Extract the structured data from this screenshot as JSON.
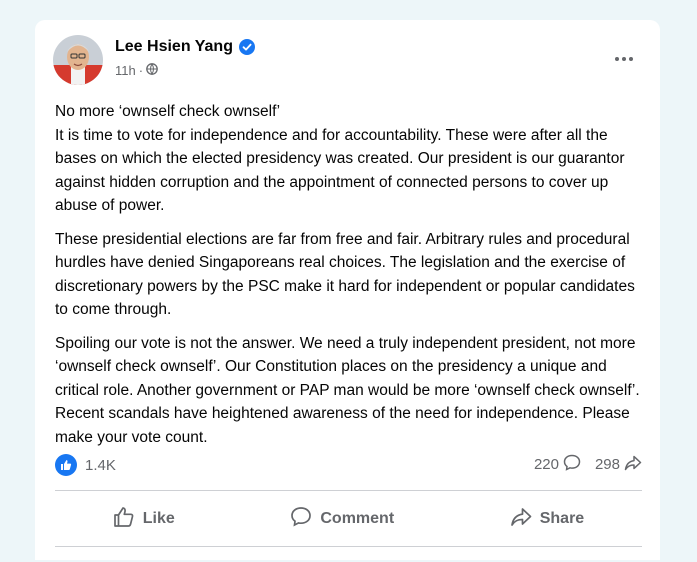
{
  "post": {
    "author": "Lee Hsien Yang",
    "timestamp": "11h",
    "privacy_separator": "·",
    "privacy_icon": "globe-icon",
    "verified_icon": "verified-badge-icon",
    "paragraphs": [
      "No more ‘ownself check ownself’\nIt is time to vote for independence and for accountability.  These were after all the bases on which the elected presidency was created.  Our president is our guarantor against hidden corruption and the appointment of connected persons to cover up abuse of power.",
      "These presidential elections are far from free and fair.  Arbitrary rules and procedural hurdles have denied Singaporeans real choices. The legislation and the exercise of discretionary powers by the PSC make it hard for independent or popular candidates to come through.",
      "Spoiling our vote is not the answer.   We need a truly independent president, not more ‘ownself check ownself’. Our Constitution places on the presidency a unique and critical role. Another government or PAP man would be more ‘ownself check ownself’.  Recent scandals have heightened awareness of the need for independence. Please make your vote count."
    ]
  },
  "stats": {
    "reactions": "1.4K",
    "comments": "220",
    "shares": "298"
  },
  "actions": {
    "like": "Like",
    "comment": "Comment",
    "share": "Share"
  },
  "colors": {
    "accent": "#1877f2",
    "secondary_text": "#65676b",
    "background": "#edf6f9"
  }
}
